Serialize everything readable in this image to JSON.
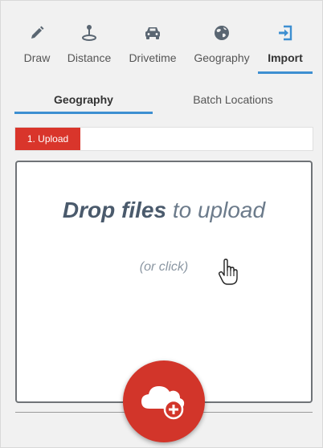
{
  "tools": [
    {
      "label": "Draw",
      "icon": "pencil-icon"
    },
    {
      "label": "Distance",
      "icon": "location-pin-icon"
    },
    {
      "label": "Drivetime",
      "icon": "car-icon"
    },
    {
      "label": "Geography",
      "icon": "globe-icon"
    },
    {
      "label": "Import",
      "icon": "import-icon",
      "active": true
    }
  ],
  "subtabs": [
    {
      "label": "Geography",
      "active": true
    },
    {
      "label": "Batch Locations"
    }
  ],
  "step": {
    "label": "1. Upload"
  },
  "dropzone": {
    "title_bold": "Drop files",
    "title_rest": " to upload",
    "hint": "(or click)"
  },
  "colors": {
    "accent": "#3d8fd1",
    "brand_red": "#d9352b",
    "icon_gray": "#5a6672"
  }
}
